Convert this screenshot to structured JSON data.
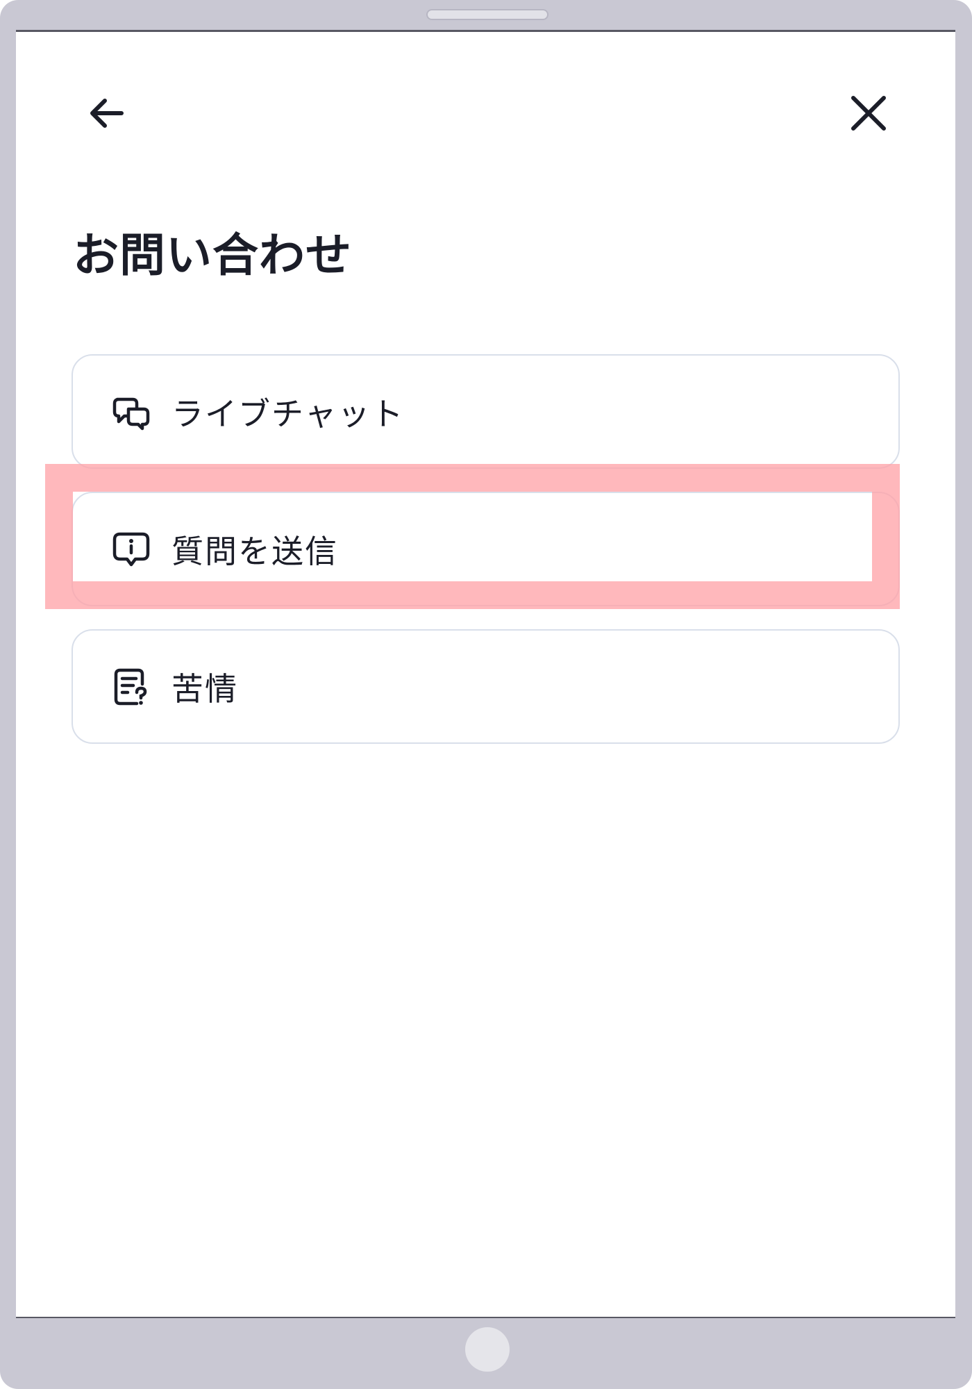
{
  "header": {
    "back_icon": "arrow-left-icon",
    "close_icon": "close-icon"
  },
  "page": {
    "title": "お問い合わせ"
  },
  "options": [
    {
      "label": "ライブチャット",
      "icon": "chat-bubbles-icon"
    },
    {
      "label": "質問を送信",
      "icon": "info-bubble-icon"
    },
    {
      "label": "苦情",
      "icon": "document-question-icon"
    }
  ],
  "colors": {
    "frame": "#c9c8d3",
    "text": "#1b1d28",
    "card_border": "#d9dfea",
    "highlight": "#ffa0a5"
  }
}
